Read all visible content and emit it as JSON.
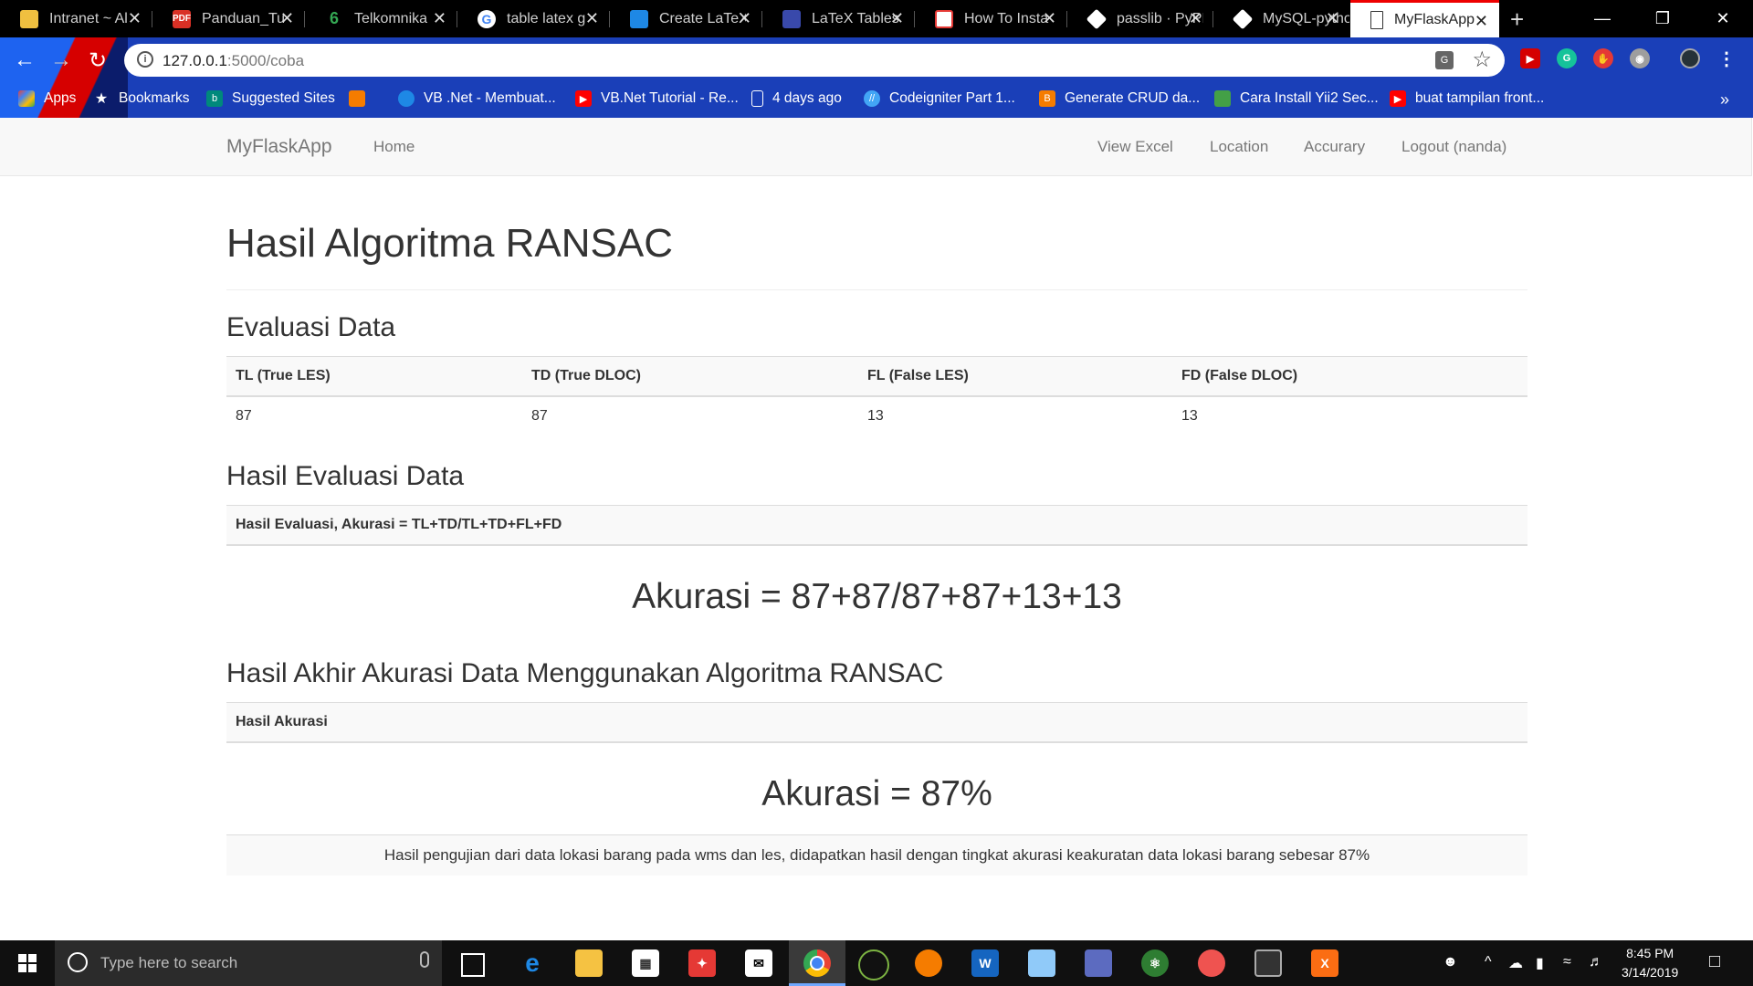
{
  "browser": {
    "tabs": [
      {
        "title": "Intranet ~ Al",
        "icon": "intranet-icon",
        "color": "#f0c040"
      },
      {
        "title": "Panduan_Tu",
        "icon": "pdf-icon",
        "color": "#d93025"
      },
      {
        "title": "Telkomnika",
        "icon": "telkomnika-icon",
        "color": "#34a853"
      },
      {
        "title": "table latex g",
        "icon": "google-icon",
        "color": "#ffffff"
      },
      {
        "title": "Create LaTeX",
        "icon": "tablesgenerator-icon",
        "color": "#1e88e5"
      },
      {
        "title": "LaTeX Tables",
        "icon": "latex-icon",
        "color": "#3949ab"
      },
      {
        "title": "How To Insta",
        "icon": "howto-icon",
        "color": "#e53935"
      },
      {
        "title": "passlib · PyPI",
        "icon": "pypi-icon",
        "color": "#ffffff"
      },
      {
        "title": "MySQL-pytho",
        "icon": "pypi-icon",
        "color": "#ffffff"
      },
      {
        "title": "MyFlaskApp",
        "icon": "document-icon",
        "color": "#ffffff"
      }
    ],
    "url_host": "127.0.0.1",
    "url_rest": ":5000/coba",
    "bookmarks": [
      {
        "label": "Apps",
        "icon": "apps-grid-icon",
        "color": "#e94235"
      },
      {
        "label": "Bookmarks",
        "icon": "star-icon",
        "color": "#ffffff"
      },
      {
        "label": "Suggested Sites",
        "icon": "bing-icon",
        "color": "#00897b"
      },
      {
        "label": "",
        "icon": "orange-square-icon",
        "color": "#f57c00"
      },
      {
        "label": "VB .Net - Membuat...",
        "icon": "vb-icon",
        "color": "#1e88e5"
      },
      {
        "label": "VB.Net Tutorial - Re...",
        "icon": "youtube-icon",
        "color": "#ff0000"
      },
      {
        "label": "4 days ago",
        "icon": "document-icon",
        "color": "#ffffff"
      },
      {
        "label": "Codeigniter Part 1...",
        "icon": "codeigniter-icon",
        "color": "#42a5f5"
      },
      {
        "label": "Generate CRUD da...",
        "icon": "blogger-icon",
        "color": "#f57c00"
      },
      {
        "label": "Cara Install Yii2 Sec...",
        "icon": "yii-icon",
        "color": "#43a047"
      },
      {
        "label": "buat tampilan front...",
        "icon": "youtube-icon",
        "color": "#ff0000"
      }
    ]
  },
  "navbar": {
    "brand": "MyFlaskApp",
    "home": "Home",
    "right": [
      "View Excel",
      "Location",
      "Accurary",
      "Logout (nanda)"
    ]
  },
  "page": {
    "title": "Hasil Algoritma RANSAC",
    "eval_heading": "Evaluasi Data",
    "eval_table": {
      "headers": [
        "TL (True LES)",
        "TD (True DLOC)",
        "FL (False LES)",
        "FD (False DLOC)"
      ],
      "row": [
        "87",
        "87",
        "13",
        "13"
      ]
    },
    "hasil_heading": "Hasil Evaluasi Data",
    "hasil_header": "Hasil Evaluasi, Akurasi = TL+TD/TL+TD+FL+FD",
    "hasil_formula": "Akurasi = 87+87/87+87+13+13",
    "akhir_heading": "Hasil Akhir Akurasi Data Menggunakan Algoritma RANSAC",
    "akhir_header": "Hasil Akurasi",
    "akhir_value": "Akurasi = 87%",
    "footnote": "Hasil pengujian dari data lokasi barang pada wms dan les, didapatkan hasil dengan tingkat akurasi keakuratan data lokasi barang sebesar 87%"
  },
  "taskbar": {
    "search_placeholder": "Type here to search",
    "time": "8:45 PM",
    "date": "3/14/2019",
    "apps": [
      "task-view-icon",
      "edge-icon",
      "file-explorer-icon",
      "store-icon",
      "gift-icon",
      "mail-icon",
      "chrome-icon",
      "app-icon",
      "origin-icon",
      "word-icon",
      "paint-icon",
      "visual-studio-icon",
      "atom-icon",
      "paint3d-icon",
      "terminal-icon",
      "xampp-icon"
    ]
  }
}
